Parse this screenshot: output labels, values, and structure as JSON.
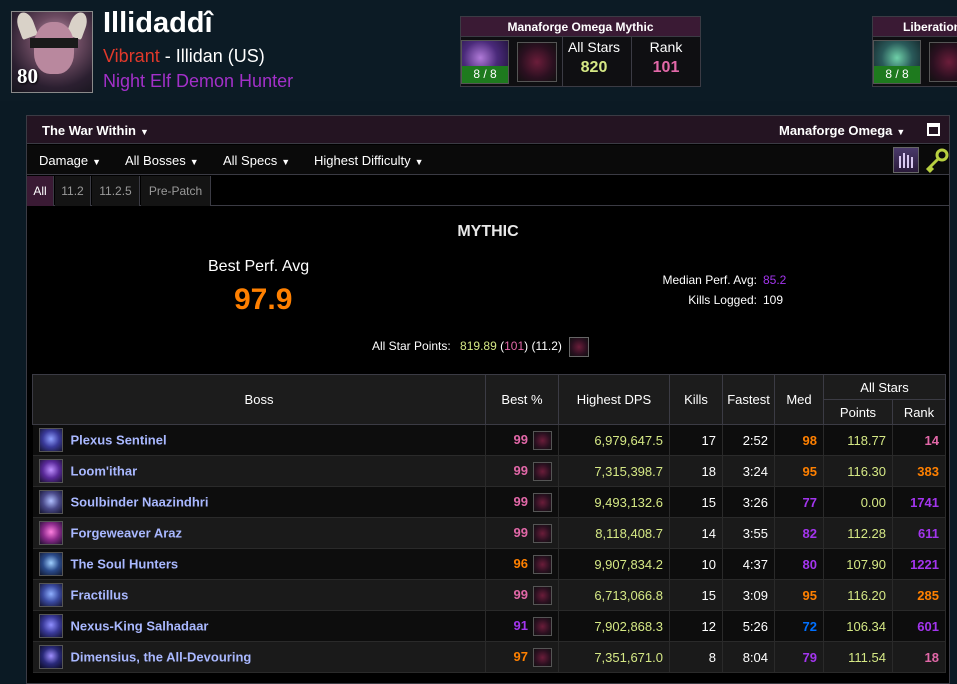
{
  "character": {
    "name": "Illidaddî",
    "level": "80",
    "guild": "Vibrant",
    "separator": " - ",
    "realm": "Illidan (US)",
    "race_class": "Night Elf Demon Hunter"
  },
  "raid_cards": [
    {
      "title": "Manaforge Omega Mythic",
      "progress": "8 / 8",
      "all_stars_label": "All Stars",
      "all_stars_value": "820",
      "rank_label": "Rank",
      "rank_value": "101"
    },
    {
      "title": "Liberation",
      "progress": "8 / 8"
    }
  ],
  "toolbar": {
    "expansion": "The War Within",
    "zone": "Manaforge Omega",
    "metric": "Damage",
    "bosses": "All Bosses",
    "specs": "All Specs",
    "difficulty": "Highest Difficulty"
  },
  "patch_tabs": [
    "All",
    "11.2",
    "11.2.5",
    "Pre-Patch"
  ],
  "summary": {
    "difficulty_title": "MYTHIC",
    "best_perf_label": "Best Perf. Avg",
    "best_perf_value": "97.9",
    "median_label": "Median Perf. Avg:",
    "median_value": "85.2",
    "kills_label": "Kills Logged:",
    "kills_value": "109",
    "asp_label": "All Star Points:",
    "asp_points": "819.89",
    "asp_open": " (",
    "asp_rank": "101",
    "asp_close": ") (11.2)"
  },
  "table": {
    "headers": {
      "boss": "Boss",
      "best": "Best %",
      "dps": "Highest DPS",
      "kills": "Kills",
      "fastest": "Fastest",
      "med": "Med",
      "all_stars": "All Stars",
      "points": "Points",
      "rank": "Rank"
    },
    "rows": [
      {
        "boss": "Plexus Sentinel",
        "best": "99",
        "dps": "6,979,647.5",
        "kills": "17",
        "fastest": "2:52",
        "med": "98",
        "points": "118.77",
        "rank": "14"
      },
      {
        "boss": "Loom'ithar",
        "best": "99",
        "dps": "7,315,398.7",
        "kills": "18",
        "fastest": "3:24",
        "med": "95",
        "points": "116.30",
        "rank": "383"
      },
      {
        "boss": "Soulbinder Naazindhri",
        "best": "99",
        "dps": "9,493,132.6",
        "kills": "15",
        "fastest": "3:26",
        "med": "77",
        "points": "0.00",
        "rank": "1741"
      },
      {
        "boss": "Forgeweaver Araz",
        "best": "99",
        "dps": "8,118,408.7",
        "kills": "14",
        "fastest": "3:55",
        "med": "82",
        "points": "112.28",
        "rank": "611"
      },
      {
        "boss": "The Soul Hunters",
        "best": "96",
        "dps": "9,907,834.2",
        "kills": "10",
        "fastest": "4:37",
        "med": "80",
        "points": "107.90",
        "rank": "1221"
      },
      {
        "boss": "Fractillus",
        "best": "99",
        "dps": "6,713,066.8",
        "kills": "15",
        "fastest": "3:09",
        "med": "95",
        "points": "116.20",
        "rank": "285"
      },
      {
        "boss": "Nexus-King Salhadaar",
        "best": "91",
        "dps": "7,902,868.3",
        "kills": "12",
        "fastest": "5:26",
        "med": "72",
        "points": "106.34",
        "rank": "601"
      },
      {
        "boss": "Dimensius, the All-Devouring",
        "best": "97",
        "dps": "7,351,671.0",
        "kills": "8",
        "fastest": "8:04",
        "med": "79",
        "points": "111.54",
        "rank": "18"
      }
    ]
  },
  "colors": {
    "legendary": "#ff8000",
    "astounding": "#e268a8",
    "epic": "#a335ee",
    "rare": "#0070ff",
    "boss_name": "#a9b8ff",
    "dps": "#d5e885"
  },
  "icons": {
    "raid_icon": "raid-icon",
    "boss_portrait": "boss-portrait-icon",
    "spec_icon": "havoc-spec-icon",
    "maximize": "maximize-icon",
    "priest_icon": "class-icon",
    "key_icon": "key-icon"
  }
}
